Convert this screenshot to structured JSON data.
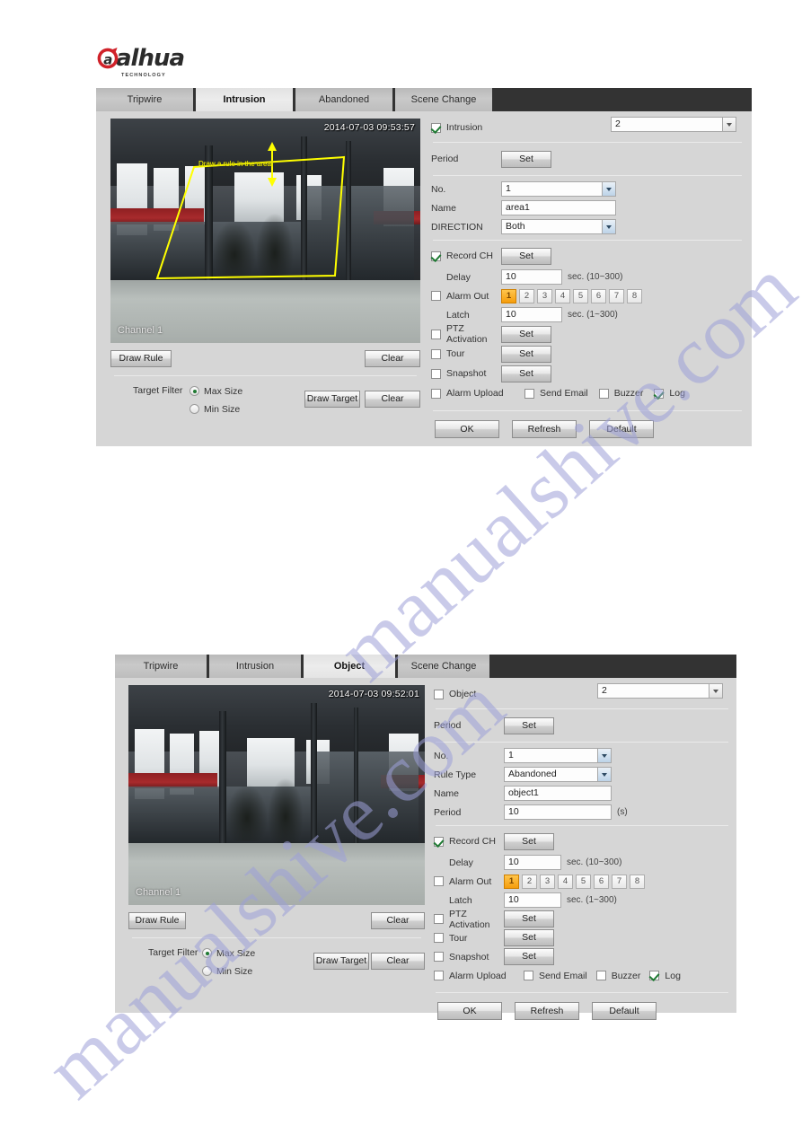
{
  "brand": {
    "name": "alhua",
    "tagline": "TECHNOLOGY"
  },
  "watermark": {
    "line1": "manualshive.com",
    "line2": "manualshive.com"
  },
  "panels": [
    {
      "id": "intrusion-panel",
      "tabs": [
        {
          "label": "Tripwire",
          "active": false
        },
        {
          "label": "Intrusion",
          "active": true
        },
        {
          "label": "Abandoned",
          "active": false
        },
        {
          "label": "Scene Change",
          "active": false
        }
      ],
      "video": {
        "timestamp": "2014-07-03 09:53:57",
        "channel": "Channel 1",
        "rule_label": "Draw a rule in the area!",
        "rule_shape": "polygon"
      },
      "left": {
        "draw_rule": "Draw Rule",
        "clear_rule": "Clear",
        "target_filter": "Target Filter",
        "max_size": "Max Size",
        "min_size": "Min Size",
        "size_selected": "Max Size",
        "draw_target": "Draw Target",
        "clear_target": "Clear"
      },
      "right": {
        "enable_label": "Intrusion",
        "enable_checked": true,
        "channel_select": "2",
        "period_label": "Period",
        "period_set": "Set",
        "no_label": "No.",
        "no_value": "1",
        "name_label": "Name",
        "name_value": "area1",
        "direction_label": "DIRECTION",
        "direction_value": "Both",
        "record_label": "Record CH",
        "record_checked": true,
        "record_set": "Set",
        "delay_label": "Delay",
        "delay_value": "10",
        "delay_hint": "sec. (10~300)",
        "alarm_out_label": "Alarm Out",
        "alarm_out_checked": false,
        "alarm_out_buttons": [
          "1",
          "2",
          "3",
          "4",
          "5",
          "6",
          "7",
          "8"
        ],
        "alarm_out_selected": "1",
        "latch_label": "Latch",
        "latch_value": "10",
        "latch_hint": "sec. (1~300)",
        "ptz_label": "PTZ Activation",
        "ptz_checked": false,
        "ptz_set": "Set",
        "tour_label": "Tour",
        "tour_checked": false,
        "tour_set": "Set",
        "snapshot_label": "Snapshot",
        "snapshot_checked": false,
        "snapshot_set": "Set",
        "alarm_upload_label": "Alarm Upload",
        "alarm_upload_checked": false,
        "send_email_label": "Send Email",
        "send_email_checked": false,
        "buzzer_label": "Buzzer",
        "buzzer_checked": false,
        "log_label": "Log",
        "log_checked": true,
        "ok": "OK",
        "refresh": "Refresh",
        "default": "Default"
      }
    },
    {
      "id": "object-panel",
      "tabs": [
        {
          "label": "Tripwire",
          "active": false
        },
        {
          "label": "Intrusion",
          "active": false
        },
        {
          "label": "Object",
          "active": true
        },
        {
          "label": "Scene Change",
          "active": false
        }
      ],
      "video": {
        "timestamp": "2014-07-03 09:52:01",
        "channel": "Channel 1",
        "rule_label": "",
        "rule_shape": "none"
      },
      "left": {
        "draw_rule": "Draw Rule",
        "clear_rule": "Clear",
        "target_filter": "Target Filter",
        "max_size": "Max Size",
        "min_size": "Min Size",
        "size_selected": "Max Size",
        "draw_target": "Draw Target",
        "clear_target": "Clear"
      },
      "right": {
        "enable_label": "Object",
        "enable_checked": false,
        "channel_select": "2",
        "period_label": "Period",
        "period_set": "Set",
        "no_label": "No.",
        "no_value": "1",
        "rule_type_label": "Rule Type",
        "rule_type_value": "Abandoned",
        "name_label": "Name",
        "name_value": "object1",
        "period2_label": "Period",
        "period2_value": "10",
        "period2_hint": "(s)",
        "record_label": "Record CH",
        "record_checked": true,
        "record_set": "Set",
        "delay_label": "Delay",
        "delay_value": "10",
        "delay_hint": "sec. (10~300)",
        "alarm_out_label": "Alarm Out",
        "alarm_out_checked": false,
        "alarm_out_buttons": [
          "1",
          "2",
          "3",
          "4",
          "5",
          "6",
          "7",
          "8"
        ],
        "alarm_out_selected": "1",
        "latch_label": "Latch",
        "latch_value": "10",
        "latch_hint": "sec. (1~300)",
        "ptz_label": "PTZ Activation",
        "ptz_checked": false,
        "ptz_set": "Set",
        "tour_label": "Tour",
        "tour_checked": false,
        "tour_set": "Set",
        "snapshot_label": "Snapshot",
        "snapshot_checked": false,
        "snapshot_set": "Set",
        "alarm_upload_label": "Alarm Upload",
        "alarm_upload_checked": false,
        "send_email_label": "Send Email",
        "send_email_checked": false,
        "buzzer_label": "Buzzer",
        "buzzer_checked": false,
        "log_label": "Log",
        "log_checked": true,
        "ok": "OK",
        "refresh": "Refresh",
        "default": "Default"
      }
    }
  ],
  "colors": {
    "panel_bg": "#d6d6d6",
    "tabbar_bg": "#333333",
    "accent_orange": "#f59d0c",
    "rule_yellow": "#ffff00",
    "check_green": "#1f7a33",
    "logo_red": "#d0222a"
  }
}
